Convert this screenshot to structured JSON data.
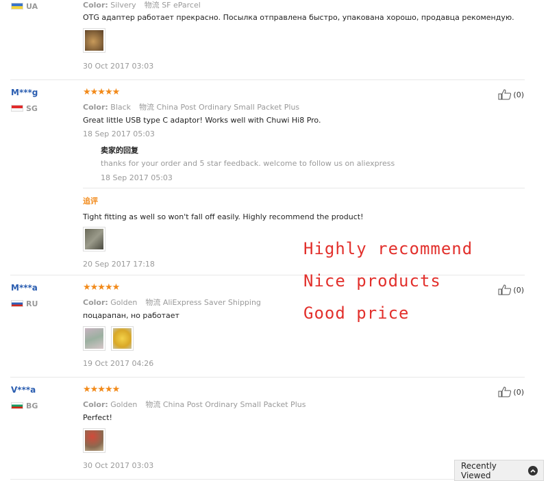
{
  "reviews": [
    {
      "country": "UA",
      "meta": {
        "color_label": "Color:",
        "color": "Silvery",
        "logistics_label": "物流",
        "logistics": "SF eParcel"
      },
      "text": "OTG адаптер работает прекрасно. Посылка отправлена быстро, упакована хорошо, продавца рекомендую.",
      "date": "30 Oct 2017 03:03"
    },
    {
      "user": "M***g",
      "country": "SG",
      "stars": "★★★★★",
      "meta": {
        "color_label": "Color:",
        "color": "Black",
        "logistics_label": "物流",
        "logistics": "China Post Ordinary Small Packet Plus"
      },
      "text": "Great little USB type C adaptor! Works well with Chuwi Hi8 Pro.",
      "date": "18 Sep 2017 05:03",
      "helpful": "(0)",
      "seller_reply": {
        "title": "卖家的回复",
        "text": "thanks for your order and 5 star feedback. welcome to follow us on aliexpress",
        "date": "18 Sep 2017 05:03"
      },
      "additional": {
        "label": "追评",
        "text": "Tight fitting as well so won't fall off easily. Highly recommend the product!",
        "date": "20 Sep 2017 17:18"
      }
    },
    {
      "user": "M***a",
      "country": "RU",
      "stars": "★★★★★",
      "meta": {
        "color_label": "Color:",
        "color": "Golden",
        "logistics_label": "物流",
        "logistics": "AliExpress Saver Shipping"
      },
      "text": "поцарапан, но работает",
      "date": "19 Oct 2017 04:26",
      "helpful": "(0)"
    },
    {
      "user": "V***a",
      "country": "BG",
      "stars": "★★★★★",
      "meta": {
        "color_label": "Color:",
        "color": "Golden",
        "logistics_label": "物流",
        "logistics": "China Post Ordinary Small Packet Plus"
      },
      "text": "Perfect!",
      "date": "30 Oct 2017 03:03",
      "helpful": "(0)"
    }
  ],
  "overlay": {
    "line1": "Highly recommend",
    "line2": "Nice products",
    "line3": "Good price"
  },
  "recently_viewed": {
    "label": "Recently Viewed"
  },
  "colors": {
    "star": "#f28a1a",
    "user": "#2a5db0",
    "overlay": "#e2302c"
  },
  "icons": {
    "helpful": "thumbs-up-icon",
    "recent": "chevron-up-icon"
  }
}
